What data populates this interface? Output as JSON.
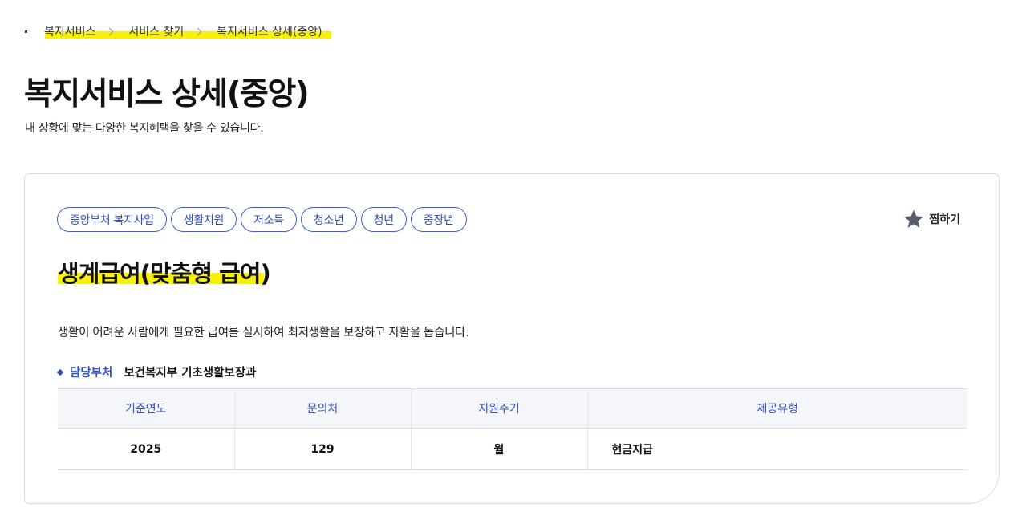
{
  "breadcrumb": {
    "items": [
      "복지서비스",
      "서비스 찾기",
      "복지서비스 상세(중앙)"
    ]
  },
  "page": {
    "title": "복지서비스 상세(중앙)",
    "subtitle": "내 상황에 맞는 다양한 복지혜택을 찾을 수 있습니다."
  },
  "service": {
    "tags": [
      "중앙부처 복지사업",
      "생활지원",
      "저소득",
      "청소년",
      "청년",
      "중장년"
    ],
    "bookmark_label": "찜하기",
    "bookmark_icon": "star-icon",
    "title": "생계급여(맞춤형 급여)",
    "description": "생활이 어려운 사람에게 필요한 급여를 실시하여 최저생활을 보장하고 자활을 돕습니다.",
    "department": {
      "label": "담당부처",
      "value": "보건복지부 기초생활보장과"
    },
    "table": {
      "headers": [
        "기준연도",
        "문의처",
        "지원주기",
        "제공유형"
      ],
      "row": [
        "2025",
        "129",
        "월",
        "현금지급"
      ]
    }
  },
  "colors": {
    "accent": "#3350c6",
    "highlight": "#f8ef0d",
    "table_header_bg": "#f4f6fa"
  }
}
